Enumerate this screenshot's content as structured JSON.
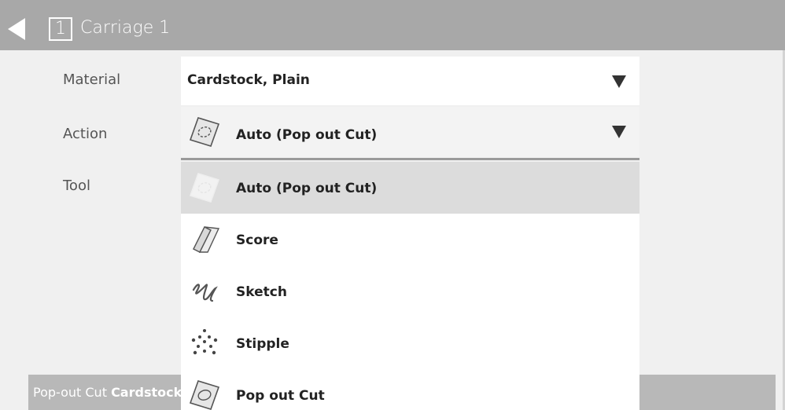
{
  "header": {
    "carriage_number": "1",
    "title": "Carriage 1"
  },
  "settings": {
    "material_label": "Material",
    "material_value": "Cardstock, Plain",
    "action_label": "Action",
    "action_value": "Auto (Pop out Cut)",
    "tool_label": "Tool"
  },
  "action_options": [
    {
      "label": "Auto (Pop out Cut)",
      "icon": "auto-pop-out-cut-icon",
      "selected": true
    },
    {
      "label": "Score",
      "icon": "score-icon",
      "selected": false
    },
    {
      "label": "Sketch",
      "icon": "sketch-icon",
      "selected": false
    },
    {
      "label": "Stipple",
      "icon": "stipple-icon",
      "selected": false
    },
    {
      "label": "Pop out Cut",
      "icon": "pop-out-cut-icon",
      "selected": false
    }
  ],
  "footer": {
    "prefix": "Pop-out Cut",
    "material": "Cardstock, Plain"
  },
  "colors": {
    "header_bg": "#a8a8a8",
    "page_bg": "#f0f0f0",
    "selected_option_bg": "#dcdcdc",
    "footer_bg": "#b8b8b8"
  }
}
